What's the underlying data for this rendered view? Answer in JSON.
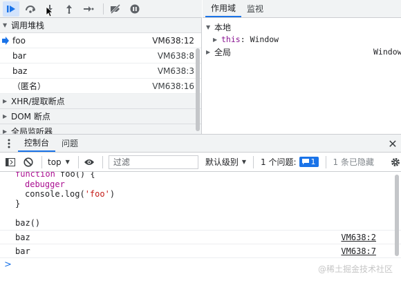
{
  "toolbar": {
    "icons": [
      "resume-icon",
      "step-over-icon",
      "step-into-icon",
      "step-out-icon",
      "step-icon",
      "deactivate-breakpoints-icon",
      "pause-on-exceptions-icon"
    ]
  },
  "call_stack": {
    "header": "调用堆栈",
    "frames": [
      {
        "name": "foo",
        "location": "VM638:12",
        "current": true
      },
      {
        "name": "bar",
        "location": "VM638:8",
        "current": false
      },
      {
        "name": "baz",
        "location": "VM638:3",
        "current": false
      },
      {
        "name": "（匿名）",
        "location": "VM638:16",
        "current": false
      }
    ]
  },
  "sections": {
    "xhr": "XHR/提取断点",
    "dom": "DOM 断点",
    "listeners": "全局监听器"
  },
  "scope_panel": {
    "tabs": [
      "作用域",
      "监视"
    ],
    "local_label": "本地",
    "this_key": "this",
    "this_value": "Window",
    "global_label": "全局",
    "global_value": "Window"
  },
  "drawer": {
    "tabs": [
      "控制台",
      "问题"
    ]
  },
  "console_toolbar": {
    "context": "top",
    "filter_placeholder": "过滤",
    "levels": "默认级别",
    "issues_label": "1 个问题:",
    "issues_count": "1",
    "hidden": "1 条已隐藏"
  },
  "console": {
    "code": {
      "line1_kw": "function",
      "line1_rest": " foo() {",
      "line2": "debugger",
      "line3_pre": "console.log(",
      "line3_str": "'foo'",
      "line3_post": ")",
      "line4": "}"
    },
    "call": "baz()",
    "messages": [
      {
        "text": "baz",
        "source": "VM638:2"
      },
      {
        "text": "bar",
        "source": "VM638:7"
      }
    ],
    "prompt": ">"
  },
  "watermark": "@稀土掘金技术社区",
  "colors": {
    "accent": "#1a73e8",
    "keyword": "#aa0d91",
    "string": "#c41a16"
  }
}
